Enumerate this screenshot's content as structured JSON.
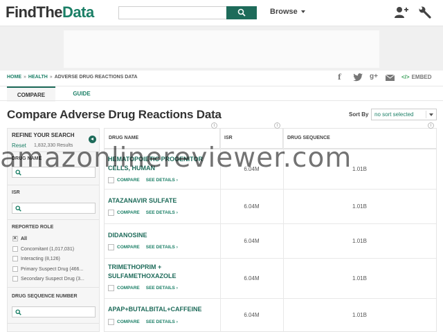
{
  "header": {
    "logo_part1": "FindThe",
    "logo_part2": "Data",
    "search": {
      "placeholder": "",
      "value": ""
    },
    "browse_label": "Browse"
  },
  "breadcrumb": {
    "home": "HOME",
    "health": "HEALTH",
    "current": "ADVERSE DRUG REACTIONS DATA",
    "separator": "»"
  },
  "share": {
    "facebook": "f",
    "googleplus": "g+",
    "embed_code": "</>",
    "embed_label": "EMBED"
  },
  "tabs": [
    {
      "label": "COMPARE",
      "active": true
    },
    {
      "label": "GUIDE",
      "active": false
    }
  ],
  "page_title": "Compare Adverse Drug Reactions Data",
  "sort": {
    "label": "Sort By",
    "selected": "no sort selected"
  },
  "sidebar": {
    "title": "REFINE YOUR SEARCH",
    "reset": "Reset",
    "result_count": "1,832,330 Results",
    "drug_name_label": "DRUG NAME",
    "isr_label": "ISR",
    "reported_role_label": "REPORTED ROLE",
    "roles": [
      {
        "label": "All",
        "checked": true
      },
      {
        "label": "Concomitant (1,017,031)",
        "checked": false
      },
      {
        "label": "Interacting (8,126)",
        "checked": false
      },
      {
        "label": "Primary Suspect Drug (466...",
        "checked": false
      },
      {
        "label": "Secondary Suspect Drug (3...",
        "checked": false
      }
    ],
    "drug_sequence_label": "DRUG SEQUENCE NUMBER"
  },
  "table": {
    "columns": [
      "DRUG NAME",
      "ISR",
      "DRUG SEQUENCE"
    ],
    "compare_label": "COMPARE",
    "see_details_label": "SEE DETAILS ›",
    "rows": [
      {
        "name": "HEMATOPOIETIC PROGENITOR CELLS, HUMAN",
        "isr": "6.04M",
        "seq": "1.01B"
      },
      {
        "name": "ATAZANAVIR SULFATE",
        "isr": "6.04M",
        "seq": "1.01B"
      },
      {
        "name": "DIDANOSINE",
        "isr": "6.04M",
        "seq": "1.01B"
      },
      {
        "name": "TRIMETHOPRIM + SULFAMETHOXAZOLE",
        "isr": "6.04M",
        "seq": "1.01B"
      },
      {
        "name": "APAP+BUTALBITAL+CAFFEINE",
        "isr": "6.04M",
        "seq": "1.01B"
      }
    ]
  },
  "watermark": "amazonlinereviewer.com"
}
